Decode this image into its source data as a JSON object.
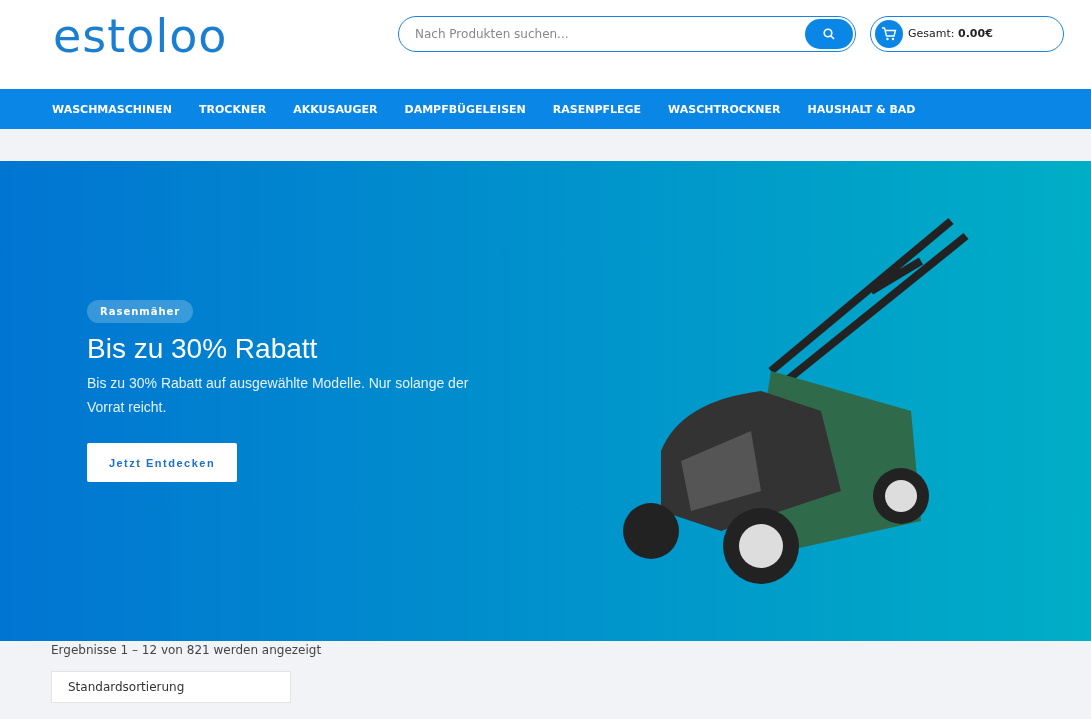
{
  "header": {
    "logo": "estoloo",
    "search": {
      "placeholder": "Nach Produkten suchen..."
    },
    "cart": {
      "total": "Gesamt: **0.00€**"
    }
  },
  "nav": {
    "items": [
      "WASCHMASCHINEN",
      "TROCKNER",
      "AKKUSAUGER",
      "DAMPFBÜGELEISEN",
      "RASENPFLEGE",
      "WASCHTROCKNER",
      "HAUSHALT & BAD"
    ]
  },
  "banner": {
    "tag": "Rasenmäher",
    "title": "Bis zu 30% Rabatt",
    "text": "Bis zu 30% Rabatt auf ausgewählte Modelle. Nur solange der Vorrat reicht.",
    "button": "Jetzt Entdecken"
  },
  "results": {
    "count": "Ergebnisse 1 – 12 von 821 werden angezeigt",
    "sort": "Standardsortierung"
  }
}
